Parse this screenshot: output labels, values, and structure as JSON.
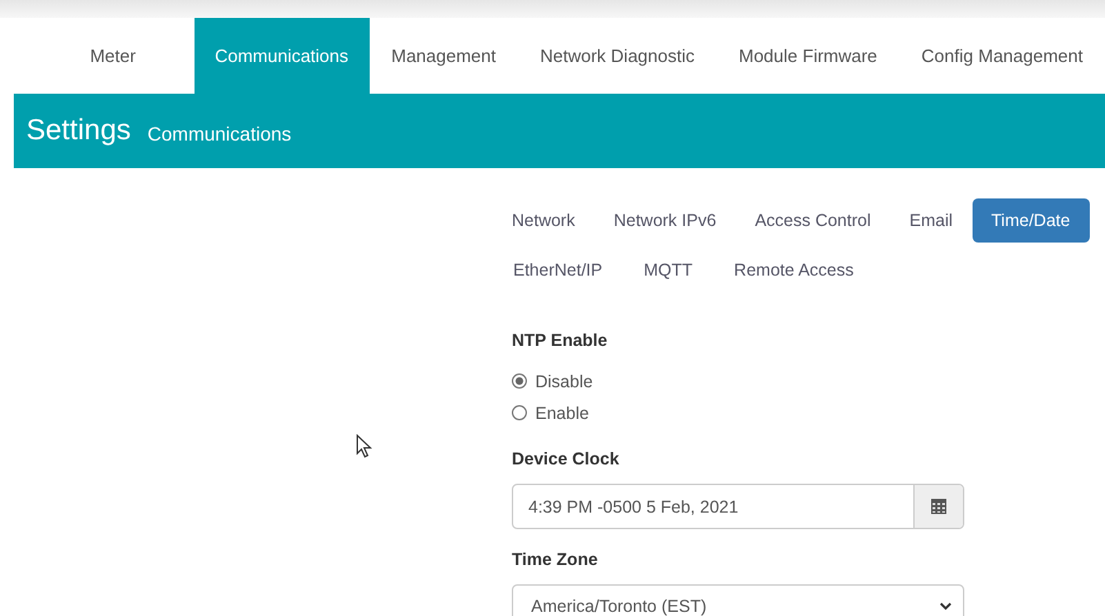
{
  "nav_tabs": [
    {
      "label": "Meter",
      "selected": false
    },
    {
      "label": "Communications",
      "selected": true
    },
    {
      "label": "Management",
      "selected": false
    },
    {
      "label": "Network Diagnostic",
      "selected": false
    },
    {
      "label": "Module Firmware",
      "selected": false
    },
    {
      "label": "Config Management",
      "selected": false
    }
  ],
  "header": {
    "title": "Settings",
    "subtitle": "Communications"
  },
  "sub_tabs": [
    [
      {
        "label": "Network",
        "selected": false
      },
      {
        "label": "Network IPv6",
        "selected": false
      },
      {
        "label": "Access Control",
        "selected": false
      },
      {
        "label": "Email",
        "selected": false
      },
      {
        "label": "Time/Date",
        "selected": true
      }
    ],
    [
      {
        "label": "EtherNet/IP",
        "selected": false
      },
      {
        "label": "MQTT",
        "selected": false
      },
      {
        "label": "Remote Access",
        "selected": false
      }
    ]
  ],
  "ntp": {
    "label": "NTP Enable",
    "options": [
      {
        "label": "Disable",
        "selected": true
      },
      {
        "label": "Enable",
        "selected": false
      }
    ]
  },
  "device_clock": {
    "label": "Device Clock",
    "value": "4:39 PM -0500 5 Feb, 2021"
  },
  "time_zone": {
    "label": "Time Zone",
    "value": "America/Toronto (EST)"
  }
}
